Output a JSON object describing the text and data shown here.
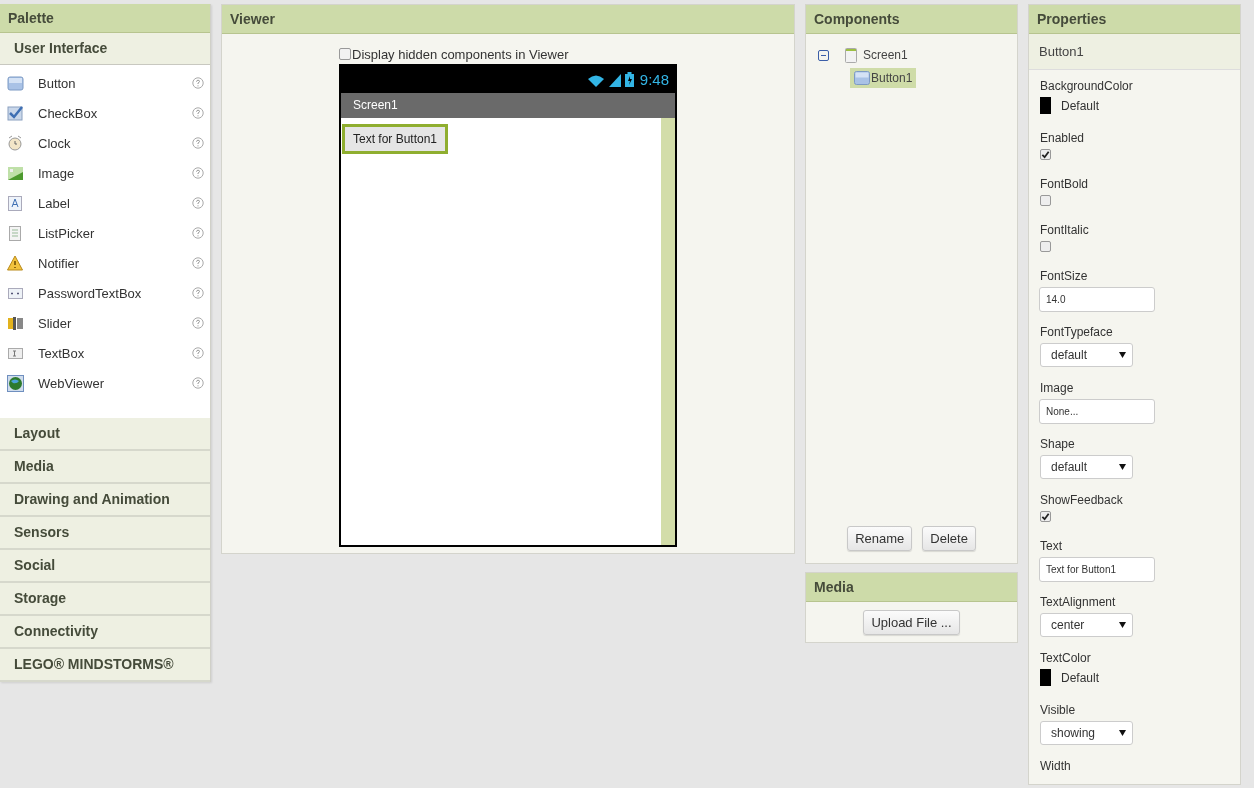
{
  "palette": {
    "title": "Palette",
    "sections": [
      {
        "label": "User Interface",
        "expanded": true,
        "items": [
          {
            "label": "Button",
            "kind": "button"
          },
          {
            "label": "CheckBox",
            "kind": "checkbox"
          },
          {
            "label": "Clock",
            "kind": "clock"
          },
          {
            "label": "Image",
            "kind": "image"
          },
          {
            "label": "Label",
            "kind": "label"
          },
          {
            "label": "ListPicker",
            "kind": "listpicker"
          },
          {
            "label": "Notifier",
            "kind": "notifier"
          },
          {
            "label": "PasswordTextBox",
            "kind": "password"
          },
          {
            "label": "Slider",
            "kind": "slider"
          },
          {
            "label": "TextBox",
            "kind": "textbox"
          },
          {
            "label": "WebViewer",
            "kind": "webviewer"
          }
        ]
      },
      {
        "label": "Layout",
        "expanded": false
      },
      {
        "label": "Media",
        "expanded": false
      },
      {
        "label": "Drawing and Animation",
        "expanded": false
      },
      {
        "label": "Sensors",
        "expanded": false
      },
      {
        "label": "Social",
        "expanded": false
      },
      {
        "label": "Storage",
        "expanded": false
      },
      {
        "label": "Connectivity",
        "expanded": false
      },
      {
        "label": "LEGO® MINDSTORMS®",
        "expanded": false
      }
    ]
  },
  "viewer": {
    "title": "Viewer",
    "hidden_components": {
      "label": "Display hidden components in Viewer",
      "checked": false
    },
    "phone": {
      "time": "9:48",
      "screen_title": "Screen1",
      "button": {
        "label": "Text for Button1",
        "selected": true
      }
    }
  },
  "components": {
    "title": "Components",
    "tree": [
      {
        "label": "Screen1",
        "kind": "screen",
        "expanded": true,
        "selected": false,
        "children": [
          {
            "label": "Button1",
            "kind": "button",
            "selected": true
          }
        ]
      }
    ],
    "buttons": [
      "Rename",
      "Delete"
    ]
  },
  "media": {
    "title": "Media",
    "button": "Upload File ..."
  },
  "properties": {
    "title": "Properties",
    "component": "Button1",
    "items": [
      {
        "label": "BackgroundColor",
        "kind": "color",
        "value": "Default"
      },
      {
        "label": "Enabled",
        "kind": "checkbox",
        "checked": true
      },
      {
        "label": "FontBold",
        "kind": "checkbox",
        "checked": false
      },
      {
        "label": "FontItalic",
        "kind": "checkbox",
        "checked": false
      },
      {
        "label": "FontSize",
        "kind": "textbox",
        "value": "14.0"
      },
      {
        "label": "FontTypeface",
        "kind": "dropdown",
        "value": "default"
      },
      {
        "label": "Image",
        "kind": "textbox",
        "value": "None..."
      },
      {
        "label": "Shape",
        "kind": "dropdown",
        "value": "default"
      },
      {
        "label": "ShowFeedback",
        "kind": "checkbox",
        "checked": true
      },
      {
        "label": "Text",
        "kind": "textbox",
        "value": "Text for Button1"
      },
      {
        "label": "TextAlignment",
        "kind": "dropdown",
        "value": "center"
      },
      {
        "label": "TextColor",
        "kind": "color",
        "value": "Default"
      },
      {
        "label": "Visible",
        "kind": "dropdown",
        "value": "showing"
      },
      {
        "label": "Width",
        "kind": "label"
      }
    ]
  }
}
